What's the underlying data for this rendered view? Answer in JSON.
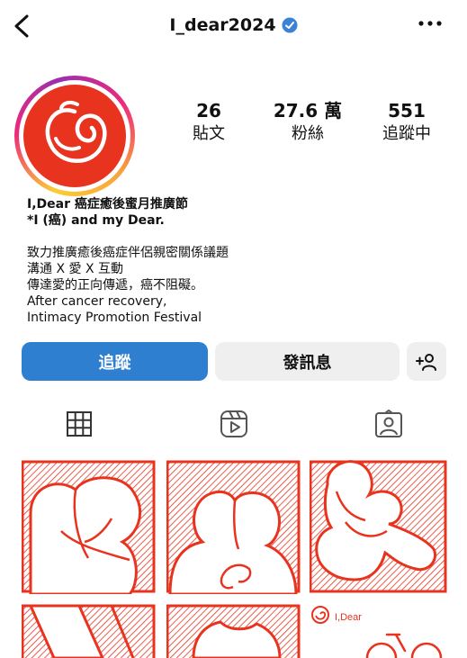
{
  "header": {
    "username": "I_dear2024",
    "icons": [
      "back-arrow-icon",
      "verified-badge-icon",
      "more-options-icon"
    ]
  },
  "stats": [
    {
      "value": "26",
      "label": "貼文"
    },
    {
      "value": "27.6 萬",
      "label": "粉絲"
    },
    {
      "value": "551",
      "label": "追蹤中"
    }
  ],
  "bio": {
    "name_line": "I,Dear  癌症癒後蜜月推廣節",
    "subtitle": "*I (癌) and my Dear.",
    "lines": [
      "致力推廣癒後癌症伴侶親密關係議題",
      "溝通 X 愛 X 互動",
      "傳達愛的正向傳遞，癌不阻礙。",
      "After cancer recovery,",
      "Intimacy Promotion Festival"
    ]
  },
  "actions": {
    "follow": "追蹤",
    "message": "發訊息"
  },
  "grid_watermark": "I,Dear",
  "colors": {
    "accent": "#2f7fd1",
    "brand_red": "#e8331f",
    "button_gray": "#efefef"
  }
}
